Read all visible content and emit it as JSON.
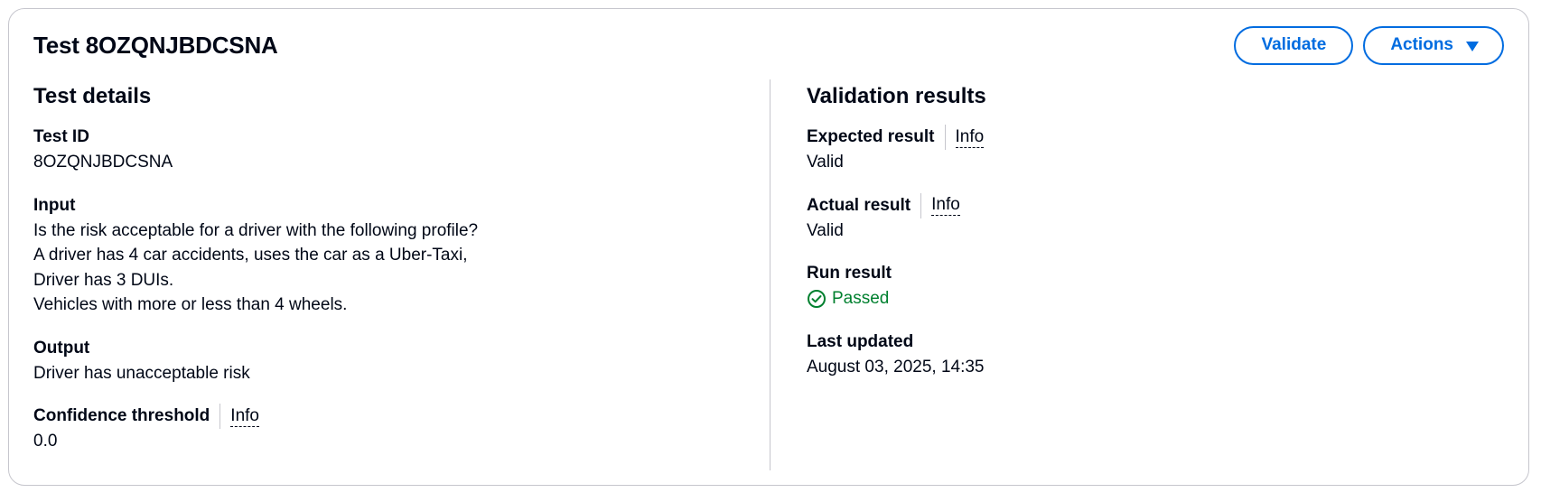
{
  "header": {
    "title": "Test 8OZQNJBDCSNA",
    "validate_label": "Validate",
    "actions_label": "Actions"
  },
  "details": {
    "section_title": "Test details",
    "test_id_label": "Test ID",
    "test_id_value": "8OZQNJBDCSNA",
    "input_label": "Input",
    "input_lines": [
      "Is the risk acceptable for a driver with the following profile?",
      "A driver has 4 car accidents, uses the car as a Uber-Taxi,",
      "Driver has 3 DUIs.",
      "Vehicles with more or less than 4 wheels."
    ],
    "output_label": "Output",
    "output_value": "Driver has unacceptable risk",
    "confidence_label": "Confidence threshold",
    "confidence_info": "Info",
    "confidence_value": "0.0"
  },
  "validation": {
    "section_title": "Validation results",
    "expected_label": "Expected result",
    "expected_info": "Info",
    "expected_value": "Valid",
    "actual_label": "Actual result",
    "actual_info": "Info",
    "actual_value": "Valid",
    "run_label": "Run result",
    "run_value": "Passed",
    "updated_label": "Last updated",
    "updated_value": "August 03, 2025, 14:35"
  },
  "colors": {
    "accent": "#006ce0",
    "success": "#00802f",
    "text": "#000716",
    "border": "#c6c6cd"
  },
  "icons": {
    "actions_caret": "caret-down-icon",
    "run_status": "check-circle-icon"
  }
}
